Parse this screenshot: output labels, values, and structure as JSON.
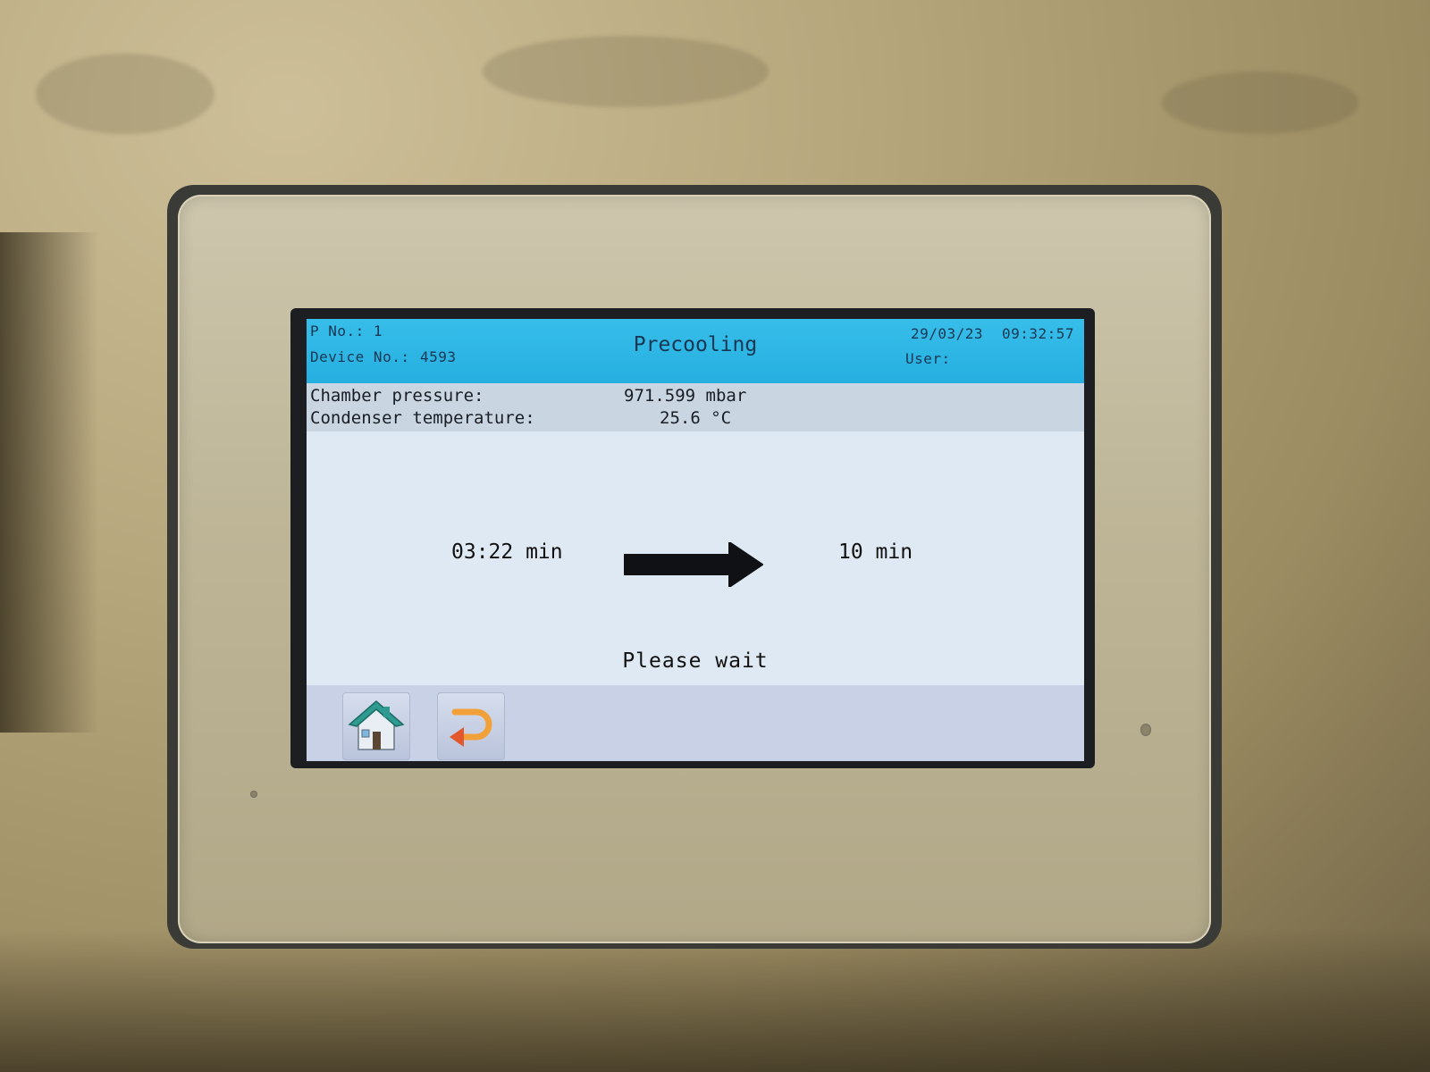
{
  "header": {
    "program_label": "P No.: 1",
    "device_label": "Device No.:",
    "device_number": "4593",
    "title": "Precooling",
    "date": "29/03/23",
    "time": "09:32:57",
    "user_label": "User:"
  },
  "readings": {
    "chamber_pressure_label": "Chamber pressure:",
    "chamber_pressure_value": "971.599 mbar",
    "condenser_temperature_label": "Condenser temperature:",
    "condenser_temperature_value": "25.6 °C"
  },
  "progress": {
    "elapsed": "03:22 min",
    "target": "10 min",
    "status": "Please wait"
  },
  "toolbar": {
    "home_icon": "home-icon",
    "back_icon": "return-arrow-icon"
  },
  "colors": {
    "header_bg": "#2ab4e3",
    "screen_bg": "#dfe9f3",
    "toolbar_bg": "#c8d1e6"
  }
}
